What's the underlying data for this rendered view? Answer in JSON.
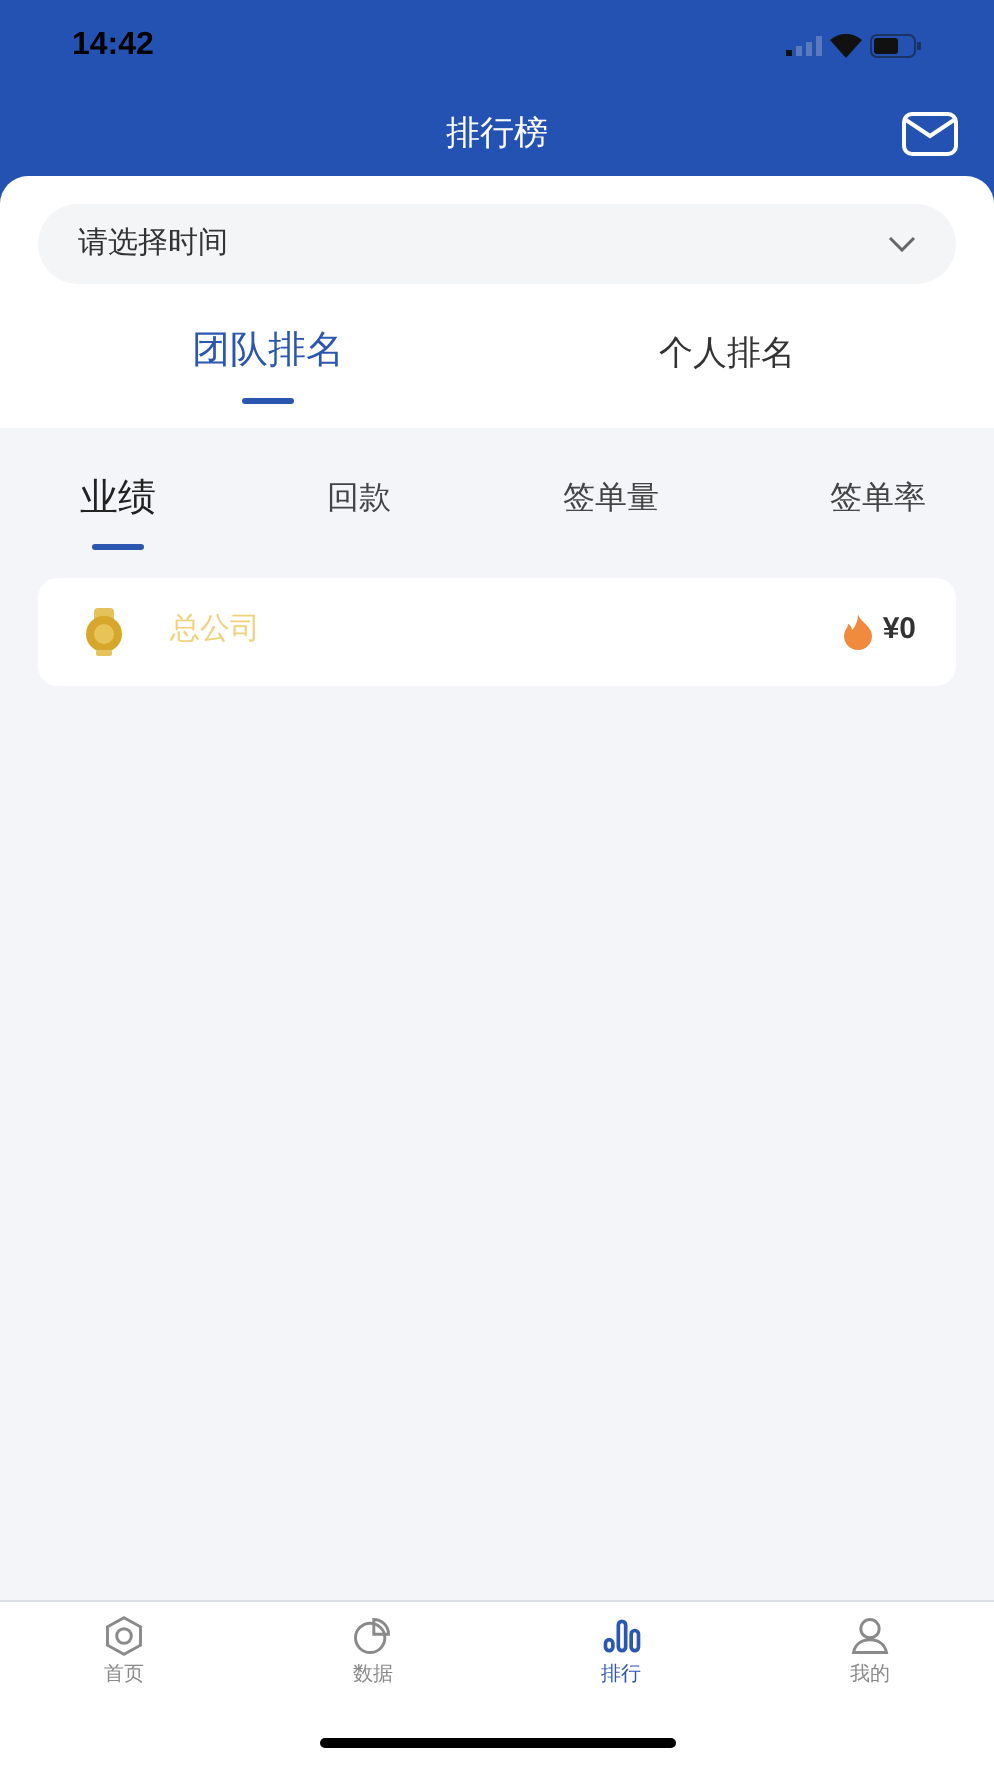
{
  "status_bar": {
    "time": "14:42"
  },
  "header": {
    "title": "排行榜"
  },
  "time_picker": {
    "placeholder": "请选择时间"
  },
  "scope_tabs": [
    {
      "label": "团队排名",
      "selected": true
    },
    {
      "label": "个人排名",
      "selected": false
    }
  ],
  "metric_tabs": [
    {
      "label": "业绩",
      "selected": true
    },
    {
      "label": "回款",
      "selected": false
    },
    {
      "label": "签单量",
      "selected": false
    },
    {
      "label": "签单率",
      "selected": false
    }
  ],
  "rankings": [
    {
      "name": "总公司",
      "value": "¥0"
    }
  ],
  "nav": [
    {
      "kind": "home",
      "label": "首页",
      "selected": false
    },
    {
      "kind": "data",
      "label": "数据",
      "selected": false
    },
    {
      "kind": "rank",
      "label": "排行",
      "selected": true
    },
    {
      "kind": "me",
      "label": "我的",
      "selected": false
    }
  ]
}
